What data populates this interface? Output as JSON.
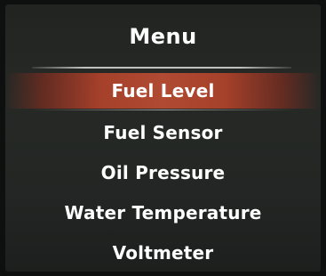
{
  "menu": {
    "title": "Menu",
    "selected_index": 0,
    "items": [
      {
        "label": "Fuel Level"
      },
      {
        "label": "Fuel Sensor"
      },
      {
        "label": "Oil Pressure"
      },
      {
        "label": "Water Temperature"
      },
      {
        "label": "Voltmeter"
      }
    ]
  },
  "colors": {
    "background": "#242624",
    "text": "#ffffff",
    "highlight": "#b04a32"
  }
}
